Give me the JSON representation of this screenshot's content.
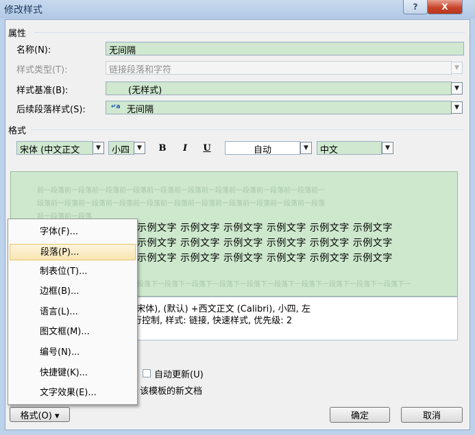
{
  "window": {
    "title": "修改样式",
    "help_label": "?",
    "close_label": "X"
  },
  "properties": {
    "section_label": "属性",
    "name_label": "名称(N):",
    "name_value": "无间隔",
    "type_label": "样式类型(T):",
    "type_value": "链接段落和字符",
    "base_label": "样式基准(B):",
    "base_value": "(无样式)",
    "next_label": "后续段落样式(S):",
    "next_value": "无间隔"
  },
  "format": {
    "section_label": "格式",
    "font_value": "宋体 (中文正文",
    "size_value": "小四",
    "bold_label": "B",
    "italic_label": "I",
    "underline_label": "U",
    "color_value": "自动",
    "lang_value": "中文"
  },
  "preview": {
    "prev_para_1": "前一段落前一段落前一段落前一段落前一段落前一段落前一段落前一段落前一段落前一段落前一",
    "prev_para_2": "段落前一段落前一段落前一段落前一段落前一段落前一段落前一段落前一段落前一段落前一段落",
    "prev_para_3": "前一段落前一段落",
    "sample_line_1": "示例文字 示例文字 示例文字 示例文字 示例文字 示例文字",
    "sample_line_2": "示例文字 示例文字 示例文字 示例文字 示例文字 示例文字",
    "sample_line_3": "示例文字 示例文字 示例文字 示例文字 示例文字 示例文字",
    "next_para": "段落下一段落下一段落下一段落下一段落下一段落下一段落下一段落下一段落下一段落下一"
  },
  "description": {
    "line_1": "(宋体), (默认) +西文正文 (Calibri), 小四, 左",
    "line_2": "行控制, 样式: 链接, 快速样式, 优先级: 2"
  },
  "options": {
    "auto_update_label": "自动更新(U)",
    "template_label": "该模板的新文档"
  },
  "buttons": {
    "format_label": "格式(O) ▾",
    "ok_label": "确定",
    "cancel_label": "取消"
  },
  "menu": {
    "items": [
      {
        "label": "字体(F)..."
      },
      {
        "label": "段落(P)...",
        "highlighted": true
      },
      {
        "label": "制表位(T)..."
      },
      {
        "label": "边框(B)..."
      },
      {
        "label": "语言(L)..."
      },
      {
        "label": "图文框(M)..."
      },
      {
        "label": "编号(N)..."
      },
      {
        "label": "快捷键(K)..."
      },
      {
        "label": "文字效果(E)..."
      }
    ]
  },
  "colors": {
    "field_green": "#cfe8cf",
    "preview_green": "#cde8cd",
    "menu_highlight": "#f8e5b2",
    "close_red": "#c8452c"
  }
}
